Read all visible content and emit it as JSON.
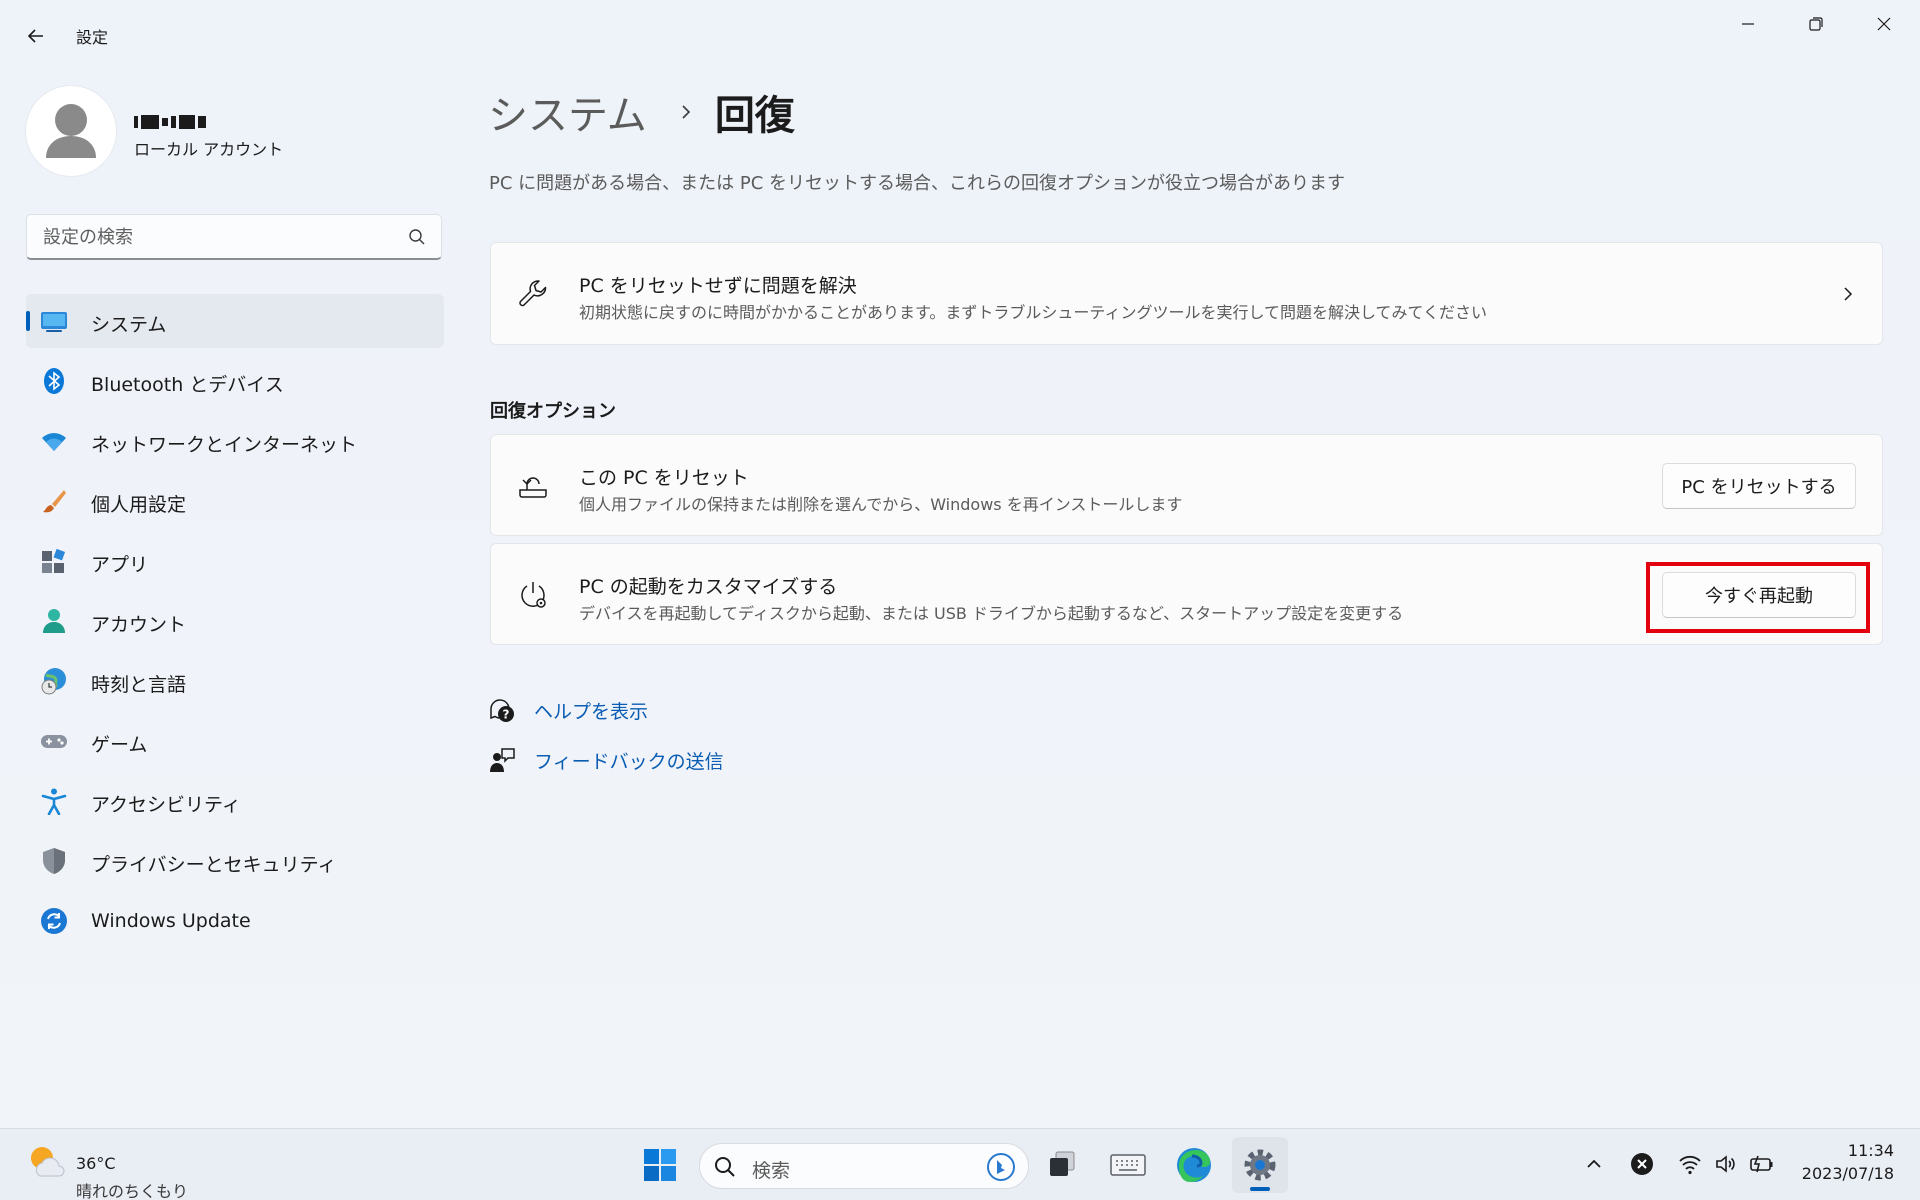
{
  "window": {
    "title": "設定"
  },
  "profile": {
    "account_type": "ローカル アカウント"
  },
  "search": {
    "placeholder": "設定の検索"
  },
  "sidebar": {
    "items": [
      {
        "label": "システム",
        "icon": "system-display-icon"
      },
      {
        "label": "Bluetooth とデバイス",
        "icon": "bluetooth-icon"
      },
      {
        "label": "ネットワークとインターネット",
        "icon": "wifi-icon"
      },
      {
        "label": "個人用設定",
        "icon": "paintbrush-icon"
      },
      {
        "label": "アプリ",
        "icon": "apps-icon"
      },
      {
        "label": "アカウント",
        "icon": "person-icon"
      },
      {
        "label": "時刻と言語",
        "icon": "globe-clock-icon"
      },
      {
        "label": "ゲーム",
        "icon": "gamepad-icon"
      },
      {
        "label": "アクセシビリティ",
        "icon": "accessibility-icon"
      },
      {
        "label": "プライバシーとセキュリティ",
        "icon": "shield-icon"
      },
      {
        "label": "Windows Update",
        "icon": "sync-icon"
      }
    ]
  },
  "breadcrumb": {
    "parent": "システム",
    "current": "回復"
  },
  "page": {
    "description": "PC に問題がある場合、または PC をリセットする場合、これらの回復オプションが役立つ場合があります"
  },
  "troubleshoot_card": {
    "title": "PC をリセットせずに問題を解決",
    "description": "初期状態に戻すのに時間がかかることがあります。まずトラブルシューティングツールを実行して問題を解決してみてください"
  },
  "recovery_section": {
    "title": "回復オプション"
  },
  "reset_card": {
    "title": "この PC をリセット",
    "description": "個人用ファイルの保持または削除を選んでから、Windows を再インストールします",
    "button": "PC をリセットする"
  },
  "startup_card": {
    "title": "PC の起動をカスタマイズする",
    "description": "デバイスを再起動してディスクから起動、または USB ドライブから起動するなど、スタートアップ設定を変更する",
    "button": "今すぐ再起動"
  },
  "links": {
    "help": "ヘルプを表示",
    "feedback": "フィードバックの送信"
  },
  "taskbar": {
    "weather_temp": "36°C",
    "weather_condition": "晴れのちくもり",
    "search_placeholder": "検索",
    "time": "11:34",
    "date": "2023/07/18"
  },
  "colors": {
    "accent": "#005fb8",
    "link": "#0a5db3",
    "highlight": "#e3000f"
  }
}
